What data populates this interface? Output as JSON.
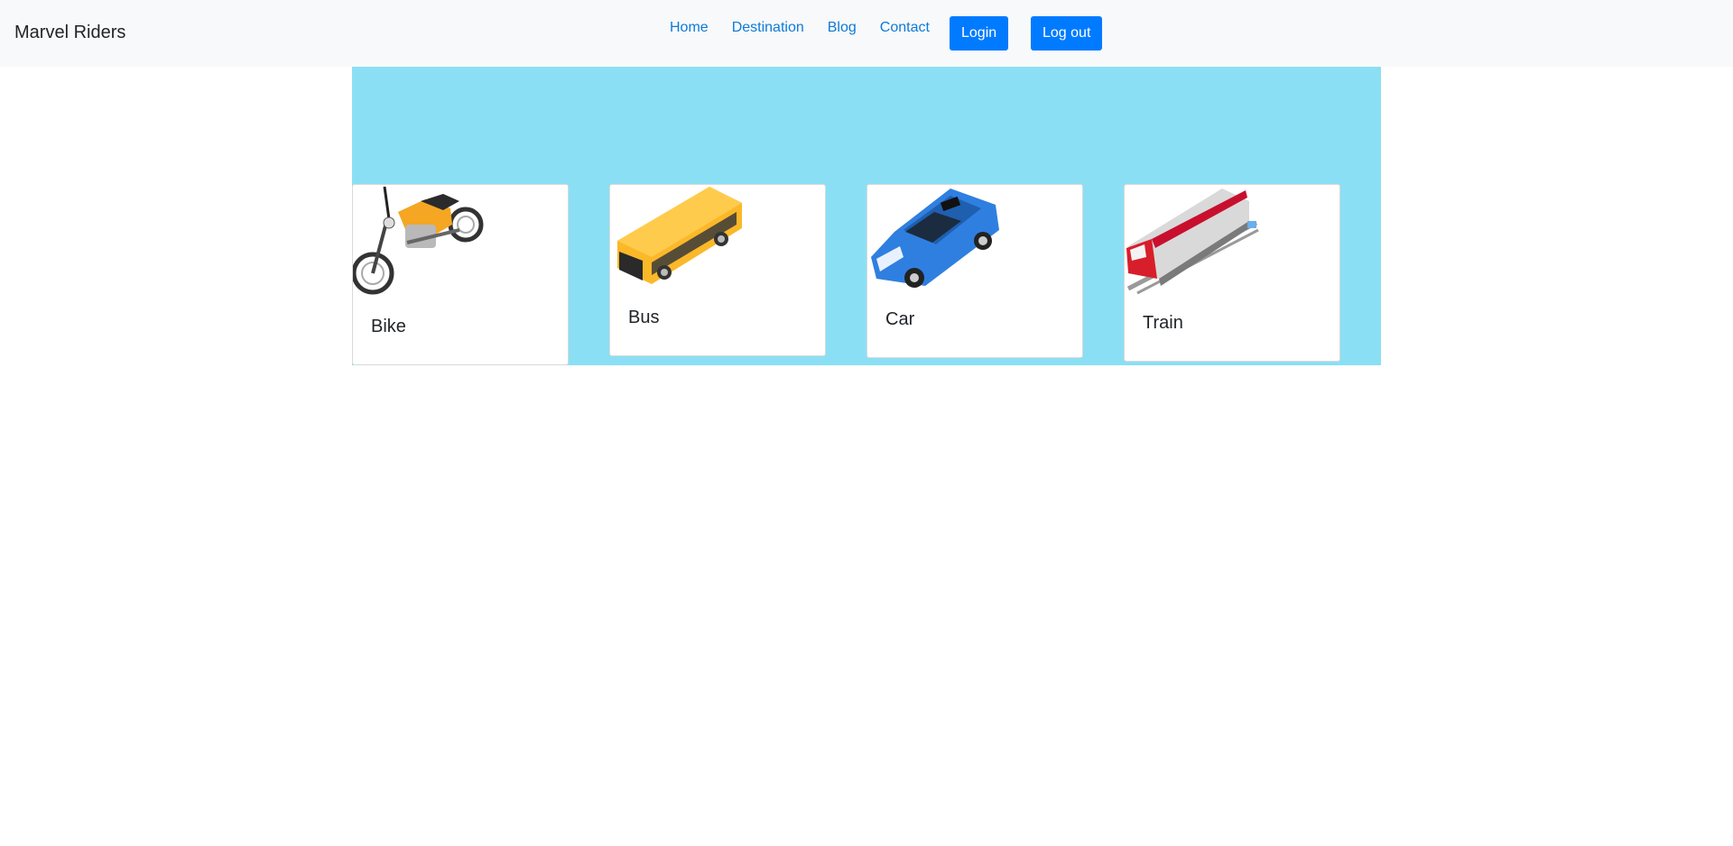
{
  "brand": "Marvel Riders",
  "nav": {
    "links": [
      "Home",
      "Destination",
      "Blog",
      "Contact"
    ],
    "login": "Login",
    "logout": "Log out"
  },
  "cards": [
    {
      "title": "Bike",
      "icon": "motorcycle-icon"
    },
    {
      "title": "Bus",
      "icon": "bus-icon"
    },
    {
      "title": "Car",
      "icon": "car-icon"
    },
    {
      "title": "Train",
      "icon": "train-icon"
    }
  ],
  "colors": {
    "hero": "#8bdff4",
    "navbar": "#f8f9fa",
    "link": "#0d7ad8",
    "button": "#007bff"
  }
}
